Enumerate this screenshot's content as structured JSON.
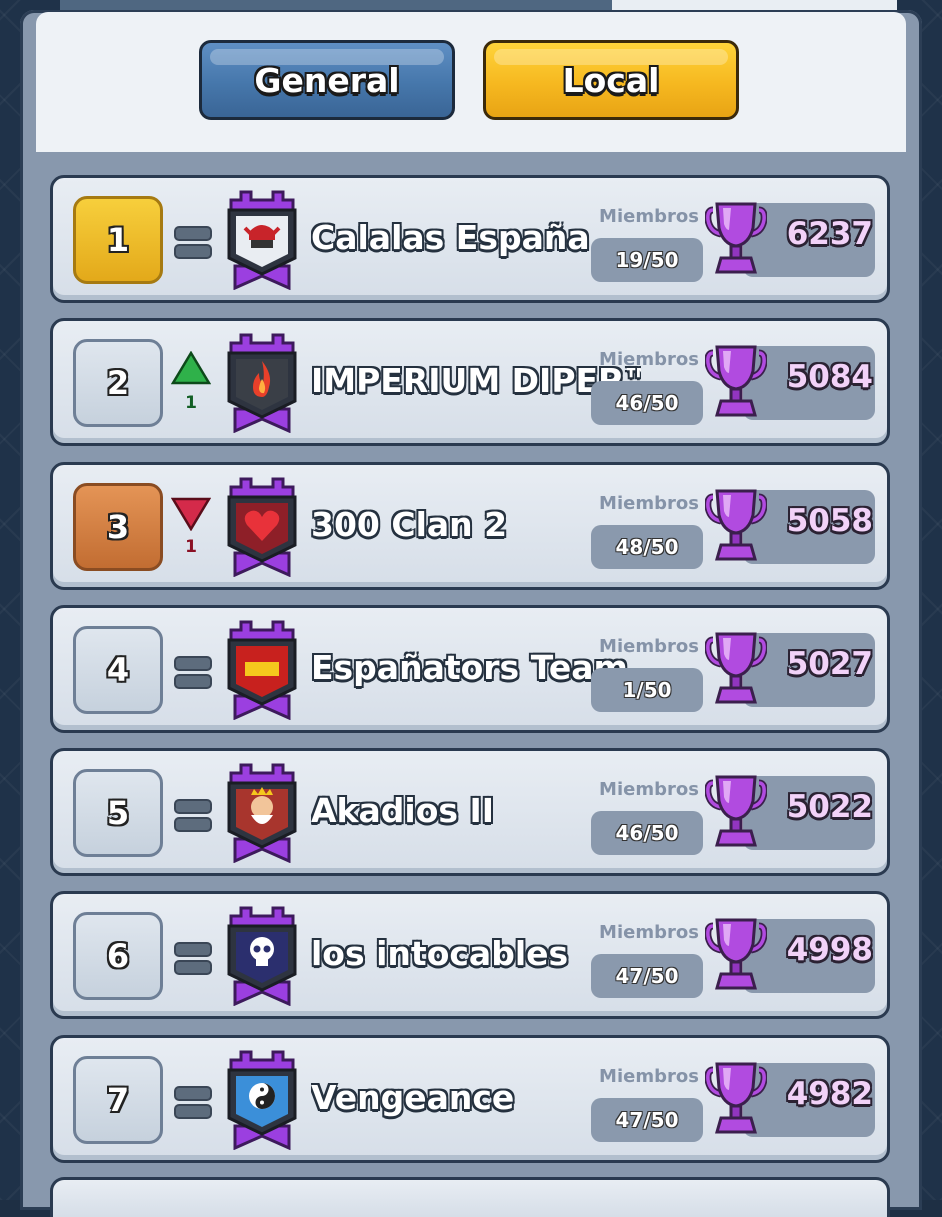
{
  "tabs": {
    "general": "General",
    "local": "Local"
  },
  "labels": {
    "members": "Miembros"
  },
  "colors": {
    "gold": "#f2c12e",
    "bronze": "#d47e3f",
    "up": "#2fb14a",
    "down": "#d42a4a",
    "trophy": "#b14be0"
  },
  "clans": [
    {
      "rank": "1",
      "rank_style": "gold",
      "change": "same",
      "change_amount": "",
      "name": "Calalas España",
      "members": "19/50",
      "trophies": "6237",
      "badge_icon": "helmet-icon",
      "badge_color": "#e9edf2"
    },
    {
      "rank": "2",
      "rank_style": "normal",
      "change": "up",
      "change_amount": "1",
      "name": "IMPERIUM DIPEP™",
      "members": "46/50",
      "trophies": "5084",
      "badge_icon": "fire-icon",
      "badge_color": "#3a3f47"
    },
    {
      "rank": "3",
      "rank_style": "bronze",
      "change": "down",
      "change_amount": "1",
      "name": "300 Clan 2",
      "members": "48/50",
      "trophies": "5058",
      "badge_icon": "heart-icon",
      "badge_color": "#8e1f28"
    },
    {
      "rank": "4",
      "rank_style": "normal",
      "change": "same",
      "change_amount": "",
      "name": "Españators Team",
      "members": "1/50",
      "trophies": "5027",
      "badge_icon": "spain-flag-icon",
      "badge_color": "#c8211e"
    },
    {
      "rank": "5",
      "rank_style": "normal",
      "change": "same",
      "change_amount": "",
      "name": "Akadios II",
      "members": "46/50",
      "trophies": "5022",
      "badge_icon": "king-icon",
      "badge_color": "#a8352d"
    },
    {
      "rank": "6",
      "rank_style": "normal",
      "change": "same",
      "change_amount": "",
      "name": "los intocables",
      "members": "47/50",
      "trophies": "4998",
      "badge_icon": "skull-icon",
      "badge_color": "#2b2f6e"
    },
    {
      "rank": "7",
      "rank_style": "normal",
      "change": "same",
      "change_amount": "",
      "name": "Vengeance",
      "members": "47/50",
      "trophies": "4982",
      "badge_icon": "yin-yang-icon",
      "badge_color": "#3b8fd9"
    }
  ]
}
